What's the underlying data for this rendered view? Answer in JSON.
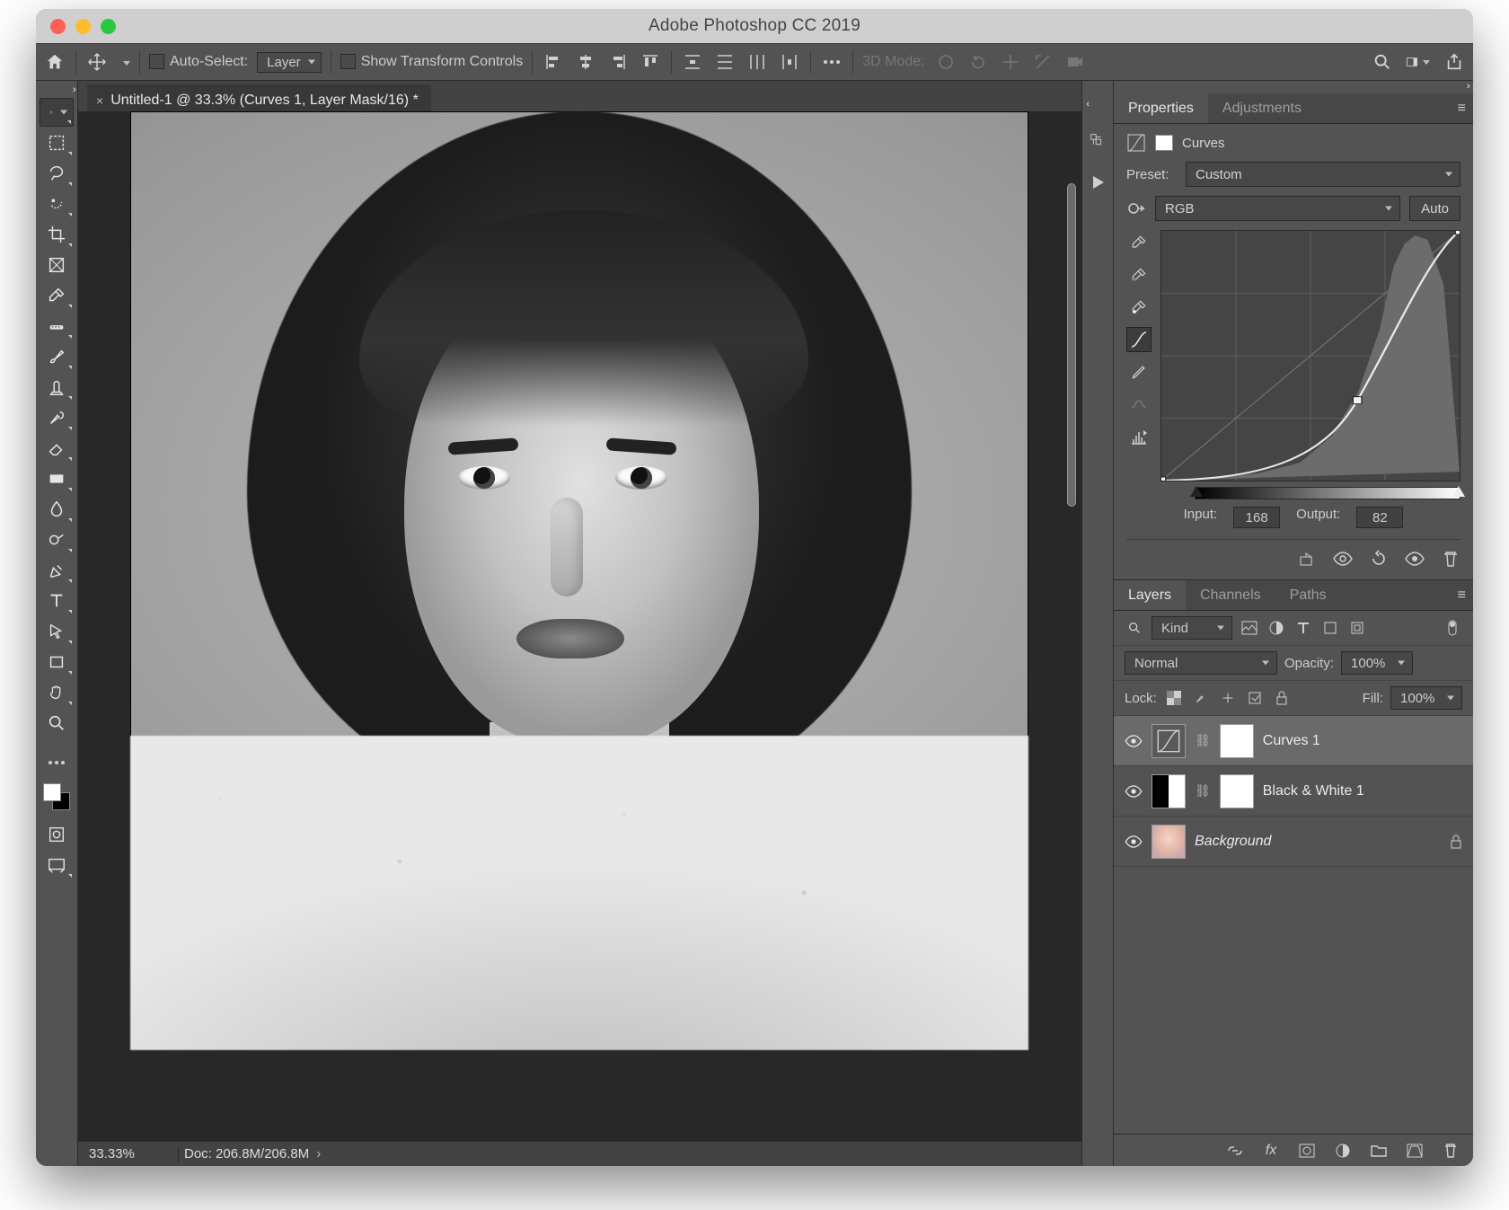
{
  "window": {
    "title": "Adobe Photoshop CC 2019"
  },
  "optionsbar": {
    "auto_select_label": "Auto-Select:",
    "auto_select_mode": "Layer",
    "show_transform_label": "Show Transform Controls",
    "threedmode_label": "3D Mode:"
  },
  "document": {
    "tab_title": "Untitled-1 @ 33.3% (Curves 1, Layer Mask/16) *",
    "zoom": "33.33%",
    "doc_info": "Doc: 206.8M/206.8M"
  },
  "panels": {
    "properties_tab": "Properties",
    "adjustments_tab": "Adjustments",
    "adj_type": "Curves",
    "preset_label": "Preset:",
    "preset_value": "Custom",
    "channel_value": "RGB",
    "auto_button": "Auto",
    "input_label": "Input:",
    "input_value": "168",
    "output_label": "Output:",
    "output_value": "82"
  },
  "layerspanel": {
    "tabs": {
      "layers": "Layers",
      "channels": "Channels",
      "paths": "Paths"
    },
    "kind_label": "Kind",
    "blend_mode": "Normal",
    "opacity_label": "Opacity:",
    "opacity_value": "100%",
    "lock_label": "Lock:",
    "fill_label": "Fill:",
    "fill_value": "100%",
    "layers": [
      {
        "name": "Curves 1"
      },
      {
        "name": "Black & White 1"
      },
      {
        "name": "Background"
      }
    ]
  },
  "icons": {
    "search": "search",
    "home": "home"
  }
}
